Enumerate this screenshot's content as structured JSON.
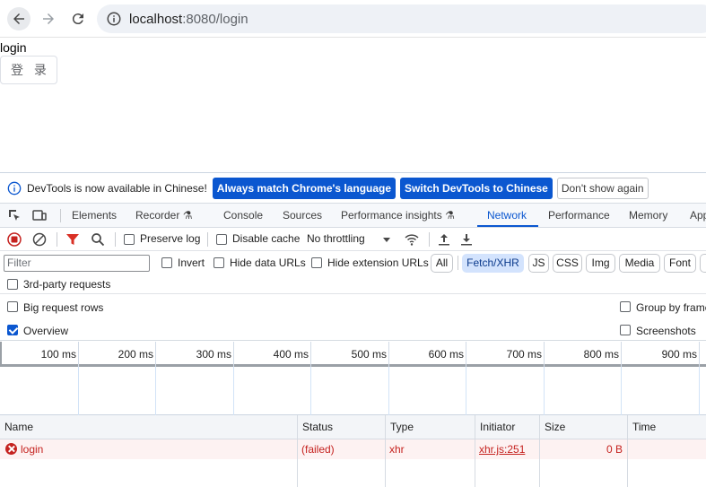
{
  "browser": {
    "url_host": "localhost",
    "url_rest": ":8080/login"
  },
  "page": {
    "text": "login",
    "login_button": "登 录"
  },
  "devtools": {
    "banner": {
      "message": "DevTools is now available in Chinese!",
      "btn_match": "Always match Chrome's language",
      "btn_switch": "Switch DevTools to Chinese",
      "btn_dismiss": "Don't show again"
    },
    "tabs": [
      "Elements",
      "Recorder",
      "Console",
      "Sources",
      "Performance insights",
      "Network",
      "Performance",
      "Memory",
      "Application"
    ],
    "toolbar": {
      "preserve_log": "Preserve log",
      "disable_cache": "Disable cache",
      "throttling": "No throttling"
    },
    "filter": {
      "placeholder": "Filter",
      "invert": "Invert",
      "hide_data_urls": "Hide data URLs",
      "hide_extension_urls": "Hide extension URLs",
      "types": [
        "All",
        "Fetch/XHR",
        "JS",
        "CSS",
        "Img",
        "Media",
        "Font"
      ],
      "selected_type": "Fetch/XHR"
    },
    "options": {
      "third_party": "3rd-party requests",
      "big_rows": "Big request rows",
      "group_by_frame": "Group by frame",
      "overview": "Overview",
      "screenshots": "Screenshots"
    },
    "timeline_ticks": [
      "100 ms",
      "200 ms",
      "300 ms",
      "400 ms",
      "500 ms",
      "600 ms",
      "700 ms",
      "800 ms",
      "900 ms"
    ],
    "table": {
      "headers": [
        "Name",
        "Status",
        "Type",
        "Initiator",
        "Size",
        "Time"
      ],
      "rows": [
        {
          "name": "login",
          "status": "(failed)",
          "type": "xhr",
          "initiator": "xhr.js:251",
          "size": "0 B",
          "time": ""
        }
      ]
    }
  },
  "colors": {
    "accent": "#0b57d0",
    "error": "#c5221f"
  }
}
